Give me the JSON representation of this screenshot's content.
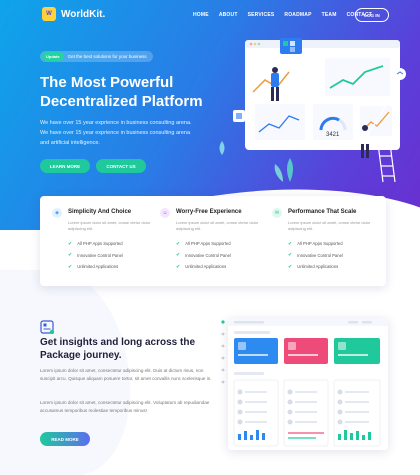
{
  "brand": {
    "name": "WorldKit.",
    "badge": "W"
  },
  "nav": {
    "items": [
      "HOME",
      "ABOUT",
      "SERVICES",
      "ROADMAP",
      "TEAM",
      "CONTACT"
    ],
    "login": "LOG IN"
  },
  "hero": {
    "tag": "Update",
    "tagline": "Get the best solutions for your business",
    "title_line1": "The Most Powerful",
    "title_line2": "Decentralized Platform",
    "description": "We have over 15 year exprience in business consulting arena. We have over 15 year exprience in business consulting arena and artificial intelligence.",
    "btn_learn": "LEARN MORE",
    "btn_contact": "CONTACT US",
    "chart_value": "3421"
  },
  "features": [
    {
      "title": "Simplicity And Choice",
      "desc": "Lorem ipsum dolor sit amet, conse ctetur dolor adipiscing elit.",
      "items": [
        "All PHP Apps Supported",
        "Innovative Control Panel",
        "Unlimited Applications"
      ],
      "color": "#2b8cf0",
      "bg": "#e3f0ff",
      "icon": "layers-icon"
    },
    {
      "title": "Worry-Free Experience",
      "desc": "Lorem ipsum dolor sit amet, conse ctetur dolor adipiscing elit.",
      "items": [
        "All PHP Apps Supported",
        "Innovative Control Panel",
        "Unlimited Applications"
      ],
      "color": "#b452e6",
      "bg": "#f5e6ff",
      "icon": "smile-icon"
    },
    {
      "title": "Performance That Scale",
      "desc": "Lorem ipsum dolor sit amet, conse ctetur dolor adipiscing elit.",
      "items": [
        "All PHP Apps Supported",
        "Innovative Control Panel",
        "Unlimited Applications"
      ],
      "color": "#20c99b",
      "bg": "#dff8ef",
      "icon": "chat-icon"
    }
  ],
  "insights": {
    "title_line1": "Get insights and long across the",
    "title_line2": "Package journey.",
    "para1": "Lorem ipsum dolor sit amet, consectetur adipiscing elit. Duis at dictum risus, non suscipit arcu. Quisque aliquam posuere tortor, sit amet convallis nunc scelerisque in.",
    "para2": "Lorem ipsum dolor sit amet, consectetur adipiscing elit. Voluptatum ab repudiandae accusamus temporibus molestiae temporibus minus!",
    "btn": "READ MORE"
  },
  "colors": {
    "accent": "#20c99b",
    "hero_start": "#0ea4ea",
    "hero_end": "#6a2fd0"
  }
}
